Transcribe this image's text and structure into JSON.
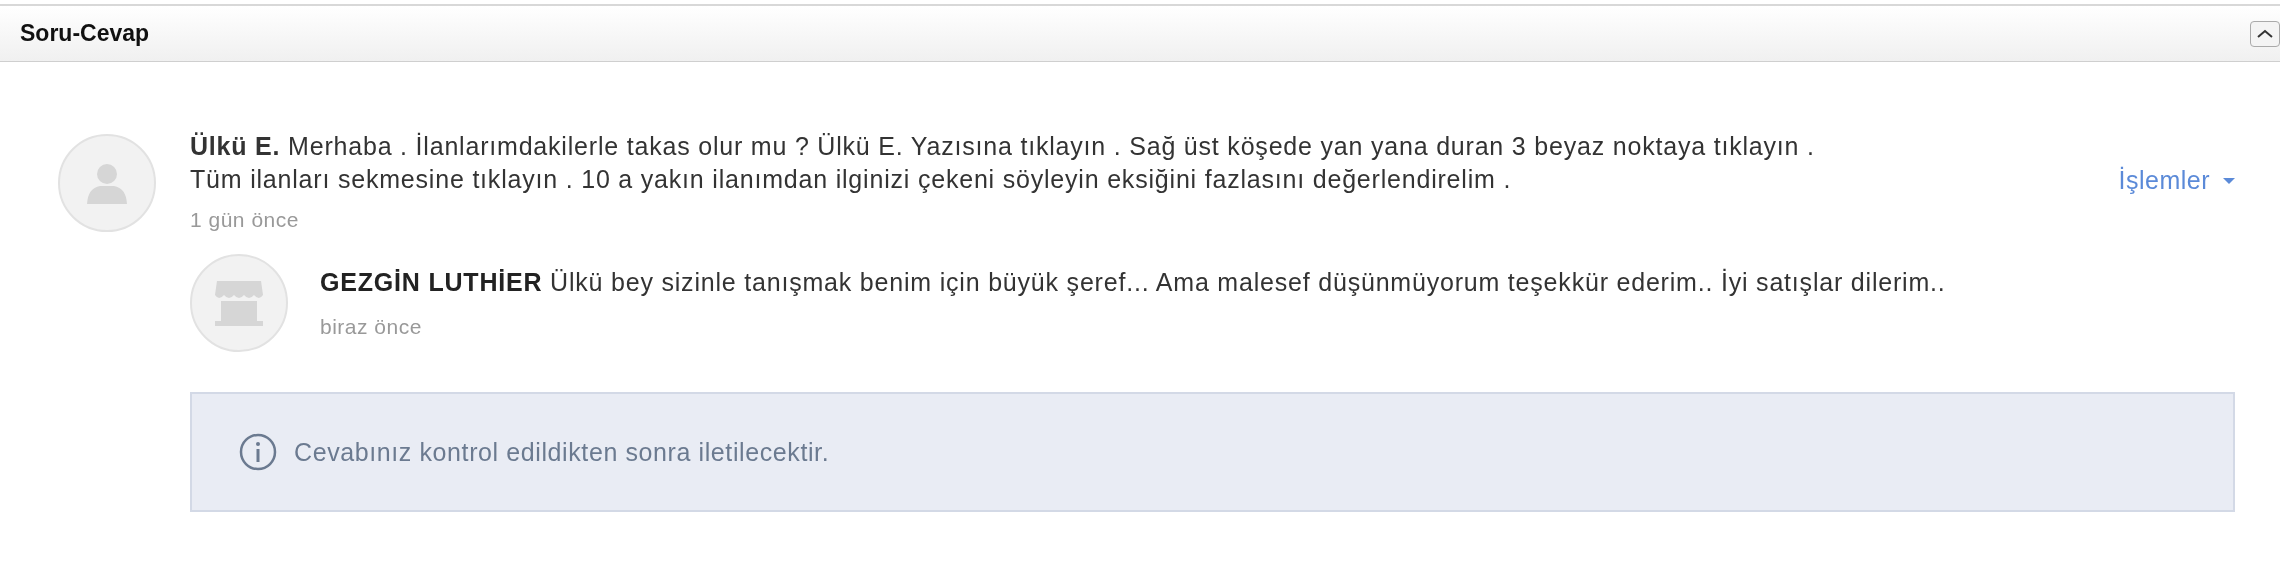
{
  "panel": {
    "title": "Soru-Cevap",
    "collapsed": false
  },
  "question": {
    "lines": [
      "**Ülkü E.** Merhaba . İlanlarımdakilerle takas olur mu ? Ülkü E. Yazısına tıklayın . Sağ üst köşede yan yana duran 3 beyaz noktaya tıklayın .",
      "Tüm ilanları sekmesine tıklayın . 10 a yakın ilanımdan ilginizi çekeni söyleyin eksiğini fazlasını değerlendirelim ."
    ],
    "time": "1 gün önce",
    "actions": "İşlemler"
  },
  "answer": {
    "author": "GEZGİN LUTHİER",
    "text": "Ülkü bey sizinle tanışmak benim için büyük şeref... Ama malesef düşünmüyorum teşekkür ederim.. İyi satışlar dilerim..",
    "time": "biraz önce"
  },
  "notice": {
    "text": "Cevabınız kontrol edildikten sonra iletilecektir."
  }
}
